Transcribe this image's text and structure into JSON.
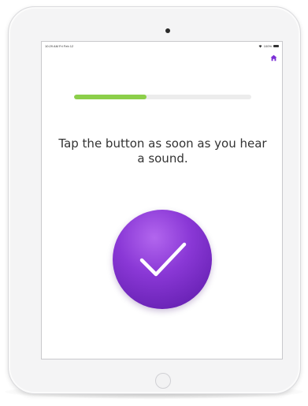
{
  "status_bar": {
    "time_date": "10:29 AM  Fri Feb 12",
    "right_status": "100%"
  },
  "header": {
    "home_icon": "home-icon",
    "accent_color": "#7b2fd6"
  },
  "progress": {
    "fraction": 0.41,
    "fill_color": "#8ccf4a"
  },
  "prompt": {
    "text": "Tap the button as soon as you hear a sound."
  },
  "tap_button": {
    "icon": "checkmark-icon",
    "color": "#8a38d6"
  }
}
